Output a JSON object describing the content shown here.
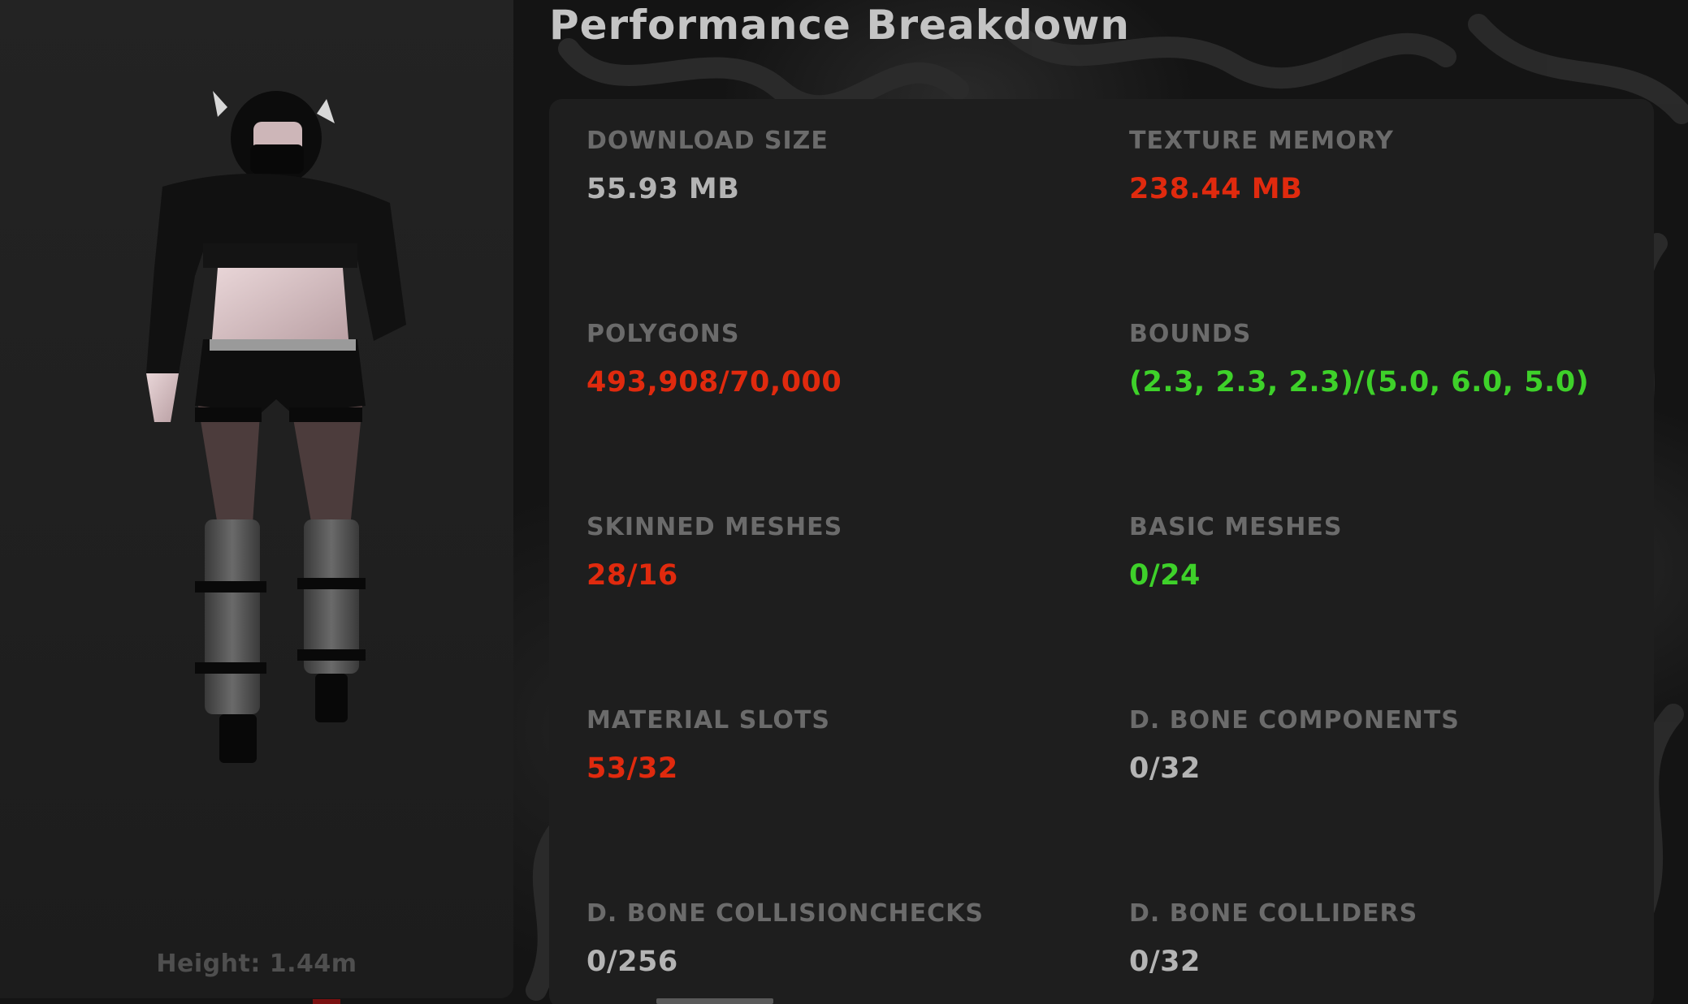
{
  "title": "Performance Breakdown",
  "avatar": {
    "height_label": "Height: 1.44m"
  },
  "colors": {
    "neutral": "#b4b4b4",
    "over_limit": "#e02a0e",
    "within_limit": "#3ed12a"
  },
  "stats": [
    {
      "label": "DOWNLOAD SIZE",
      "value": "55.93 MB",
      "status": "neutral"
    },
    {
      "label": "TEXTURE MEMORY",
      "value": "238.44 MB",
      "status": "over_limit"
    },
    {
      "label": "POLYGONS",
      "value": "493,908/70,000",
      "status": "over_limit"
    },
    {
      "label": "BOUNDS",
      "value": "(2.3, 2.3, 2.3)/(5.0, 6.0, 5.0)",
      "status": "within_limit"
    },
    {
      "label": "SKINNED MESHES",
      "value": "28/16",
      "status": "over_limit"
    },
    {
      "label": "BASIC MESHES",
      "value": "0/24",
      "status": "within_limit"
    },
    {
      "label": "MATERIAL SLOTS",
      "value": "53/32",
      "status": "over_limit"
    },
    {
      "label": "D. BONE COMPONENTS",
      "value": "0/32",
      "status": "neutral"
    },
    {
      "label": "D. BONE COLLISIONCHECKS",
      "value": "0/256",
      "status": "neutral"
    },
    {
      "label": "D. BONE COLLIDERS",
      "value": "0/32",
      "status": "neutral"
    }
  ]
}
